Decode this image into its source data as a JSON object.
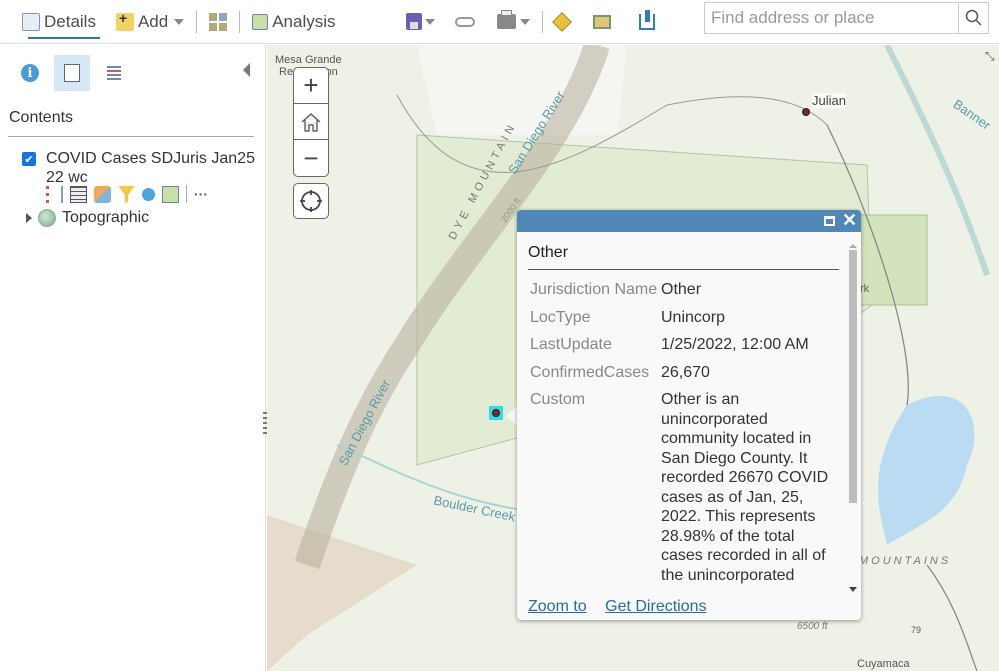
{
  "toolbar": {
    "details_label": "Details",
    "add_label": "Add",
    "analysis_label": "Analysis",
    "icons": [
      "details-icon",
      "add-icon",
      "grid-apps-icon",
      "analysis-icon",
      "save-icon",
      "link-icon",
      "print-icon",
      "directions-icon",
      "measure-icon",
      "bookmarks-icon"
    ]
  },
  "search": {
    "placeholder": "Find address or place",
    "value": ""
  },
  "sidebar": {
    "tabs": [
      "about-tab",
      "content-tab",
      "legend-tab"
    ],
    "contents_title": "Contents",
    "layers": [
      {
        "name": "COVID Cases SDJuris Jan25 22 wc",
        "checked": true
      }
    ],
    "layer_tools": [
      "show-table-of-contents",
      "show-table",
      "change-style",
      "filter",
      "perform-analysis",
      "show-item-details",
      "more-options"
    ],
    "more_label": "···",
    "basemap": "Topographic"
  },
  "map": {
    "labels": {
      "mesa_grande": "Mesa Grande",
      "reservation": "Reservation",
      "julian": "Julian",
      "banner": "Banner",
      "dye_mountain": "DYE MOUNTAIN",
      "san_diego_river_1": "San Diego River",
      "san_diego_river_2": "San Diego River",
      "boulder_creek": "Boulder Creek",
      "elev_2000": "2000 ft",
      "elev_6500": "6500 ft",
      "mountains": "MOUNTAINS",
      "cuyamaca": "Cuyamaca",
      "park": "rk",
      "route": "79"
    },
    "colors": {
      "water": "#b9dcf3",
      "park": "#dbe9c9",
      "marker_highlight": "#32d9e8"
    }
  },
  "popup": {
    "title": "Other",
    "fields": [
      {
        "key": "Jurisdiction Name",
        "value": "Other"
      },
      {
        "key": "LocType",
        "value": "Unincorp"
      },
      {
        "key": "LastUpdate",
        "value": "1/25/2022, 12:00 AM"
      },
      {
        "key": "ConfirmedCases",
        "value": "26,670"
      },
      {
        "key": "Custom",
        "value": "Other is an unincorporated community located in San Diego County. It recorded 26670 COVID cases as of Jan, 25, 2022. This represents 28.98% of the total cases recorded in all of the unincorporated"
      }
    ],
    "zoom_to": "Zoom to",
    "get_directions": "Get Directions",
    "header_color": "#4f88b6"
  }
}
